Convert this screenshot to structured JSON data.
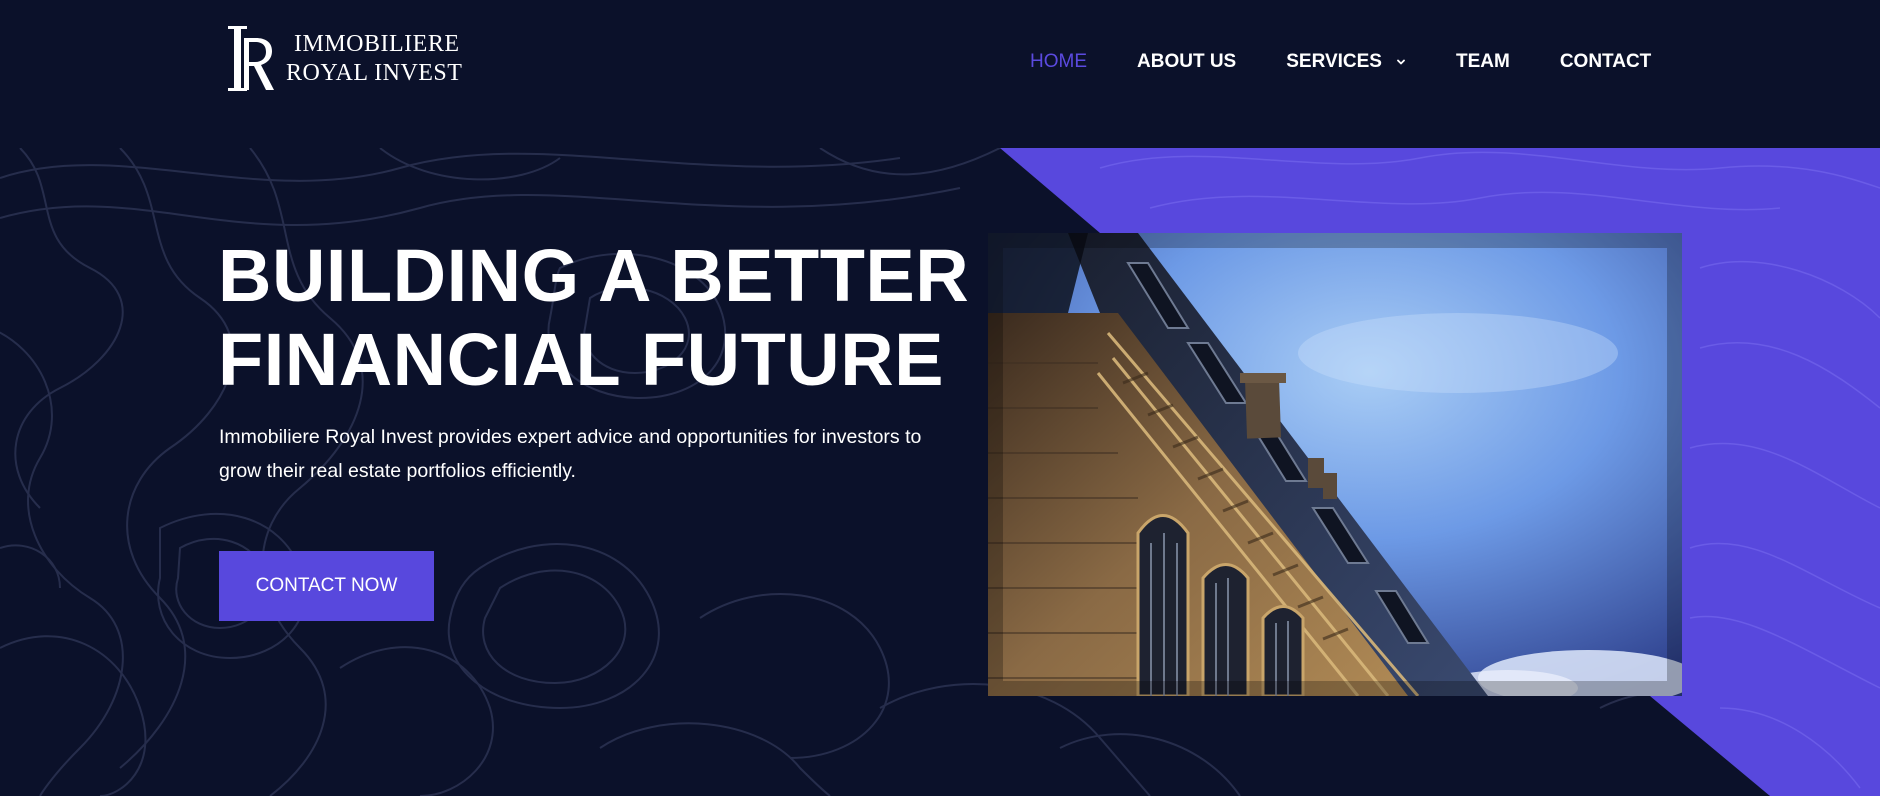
{
  "header": {
    "logo": {
      "monogram": "IR",
      "line1": "IMMOBILIERE",
      "line2": "ROYAL INVEST"
    },
    "nav": [
      {
        "label": "HOME",
        "active": true
      },
      {
        "label": "ABOUT US",
        "active": false
      },
      {
        "label": "SERVICES",
        "active": false,
        "has_dropdown": true
      },
      {
        "label": "TEAM",
        "active": false
      },
      {
        "label": "CONTACT",
        "active": false
      }
    ]
  },
  "hero": {
    "headline_line1": "BUILDING A BETTER",
    "headline_line2": "FINANCIAL FUTURE",
    "description": "Immobiliere Royal Invest provides expert advice and opportunities for investors to grow their real estate portfolios efficiently.",
    "cta_label": "CONTACT NOW",
    "image": "building-facade-photo"
  },
  "colors": {
    "background": "#0b112a",
    "accent": "#5848dd",
    "nav_active": "#5b4ae0",
    "text": "#ffffff"
  },
  "icons": {
    "dropdown": "chevron-down-icon",
    "logo": "ir-monogram-icon"
  }
}
